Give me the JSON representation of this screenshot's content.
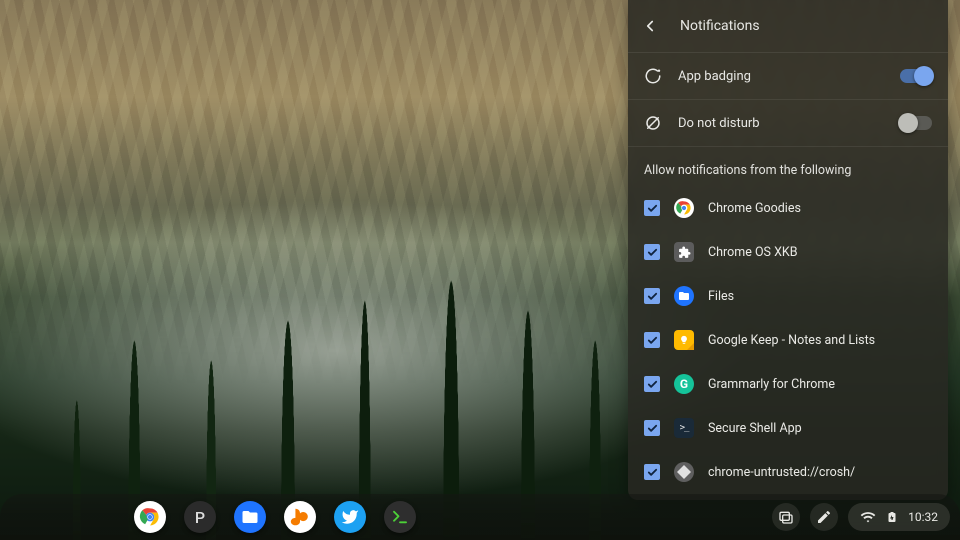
{
  "panel": {
    "title": "Notifications",
    "toggles": {
      "app_badging": {
        "label": "App badging",
        "on": true
      },
      "dnd": {
        "label": "Do not disturb",
        "on": false
      }
    },
    "section_label": "Allow notifications from the following",
    "apps": [
      {
        "name": "Chrome Goodies",
        "icon": "chrome",
        "checked": true
      },
      {
        "name": "Chrome OS XKB",
        "icon": "puzzle",
        "checked": true
      },
      {
        "name": "Files",
        "icon": "files",
        "checked": true
      },
      {
        "name": "Google Keep - Notes and Lists",
        "icon": "keep",
        "checked": true
      },
      {
        "name": "Grammarly for Chrome",
        "icon": "gram",
        "checked": true
      },
      {
        "name": "Secure Shell App",
        "icon": "shell",
        "checked": true
      },
      {
        "name": "chrome-untrusted://crosh/",
        "icon": "crosh",
        "checked": true
      }
    ]
  },
  "shelf": {
    "apps": [
      "chrome",
      "p",
      "files",
      "orange",
      "twitter",
      "terminal"
    ]
  },
  "tray": {
    "time": "10:32"
  }
}
